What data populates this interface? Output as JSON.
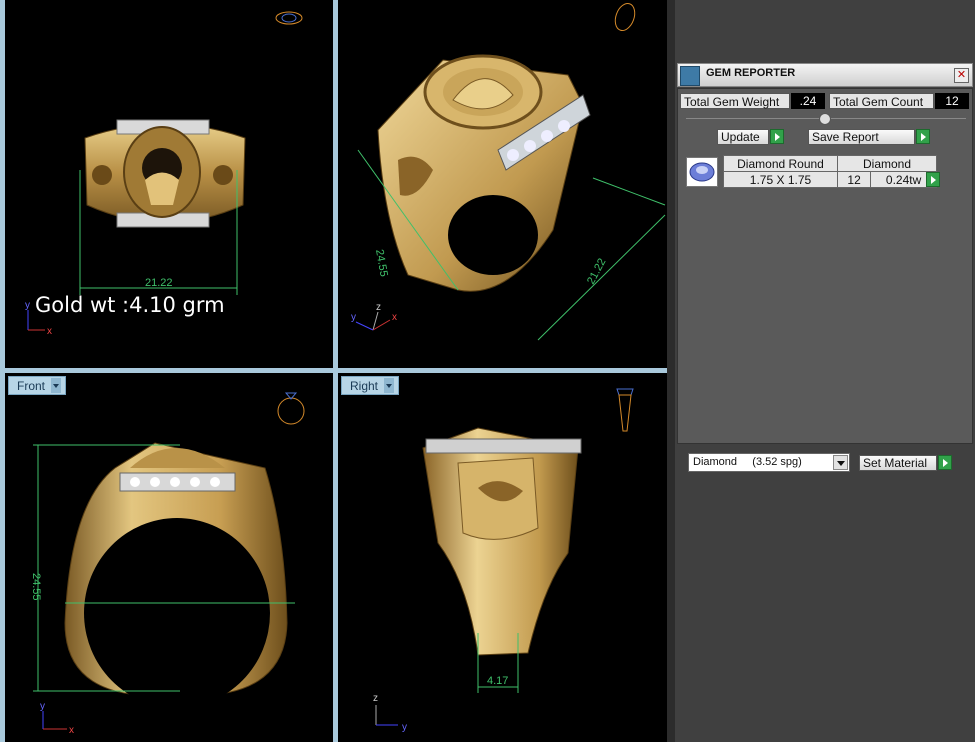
{
  "viewports": {
    "top_left": {
      "gold_weight": "Gold wt :4.10 grm",
      "dim_width": "21.22"
    },
    "top_right": {
      "dim_height": "24.55",
      "dim_width": "21.22"
    },
    "bottom_left": {
      "label": "Front",
      "dim_height": "24.55"
    },
    "bottom_right": {
      "label": "Right",
      "dim_width": "4.17"
    }
  },
  "gem_reporter": {
    "title": "GEM REPORTER",
    "close": "✕",
    "total_gem_weight_label": "Total Gem Weight",
    "total_gem_weight": ".24",
    "total_gem_count_label": "Total Gem Count",
    "total_gem_count": "12",
    "update_label": "Update",
    "save_report_label": "Save Report",
    "gems": [
      {
        "name": "Diamond Round",
        "size": "1.75 X 1.75",
        "material": "Diamond",
        "count": "12",
        "weight": "0.24tw"
      }
    ],
    "material_select": "Diamond     (3.52 spg)",
    "set_material_label": "Set Material"
  },
  "axes": {
    "x": "x",
    "y": "y",
    "z": "z"
  },
  "colors": {
    "gold": "#c9a55a",
    "dimension": "#3fc06a",
    "viewport_label": "#b7d5e6",
    "go_button": "#31a14a"
  }
}
